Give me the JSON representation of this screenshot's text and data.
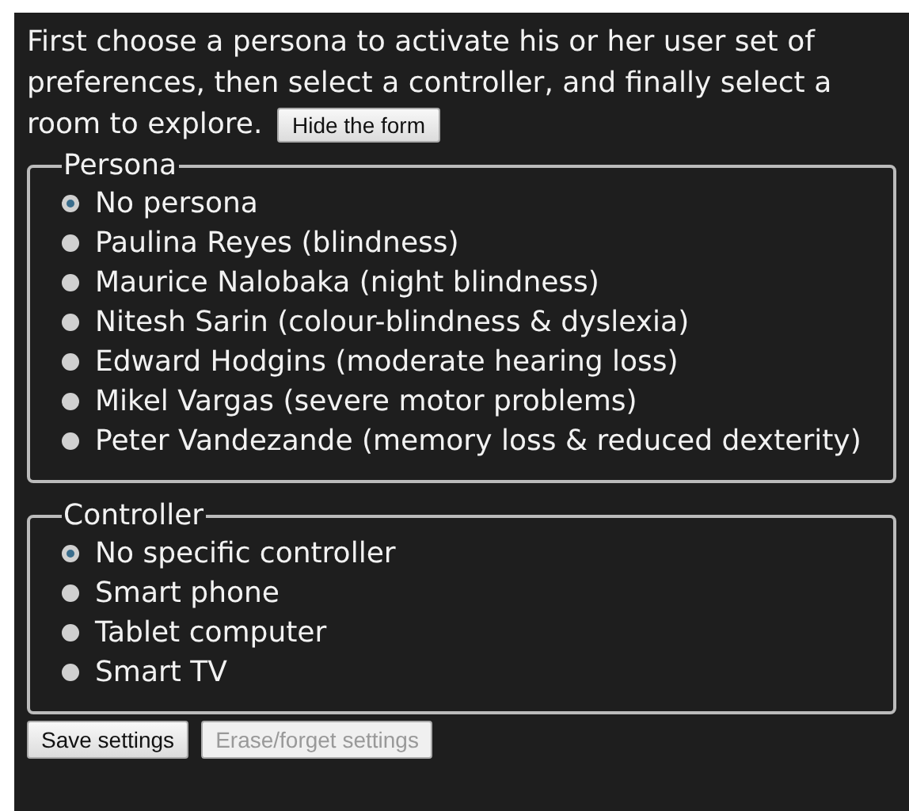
{
  "intro": {
    "text": "First choose a persona to activate his or her user set of preferences, then select a controller, and finally select a room to explore.",
    "button": "Hide the form"
  },
  "groups": [
    {
      "legend": "Persona",
      "options": [
        {
          "label": "No persona",
          "selected": true
        },
        {
          "label": "Paulina Reyes (blindness)",
          "selected": false
        },
        {
          "label": "Maurice Nalobaka (night blindness)",
          "selected": false
        },
        {
          "label": "Nitesh Sarin (colour-blindness & dyslexia)",
          "selected": false
        },
        {
          "label": "Edward Hodgins (moderate hearing loss)",
          "selected": false
        },
        {
          "label": "Mikel Vargas (severe motor problems)",
          "selected": false
        },
        {
          "label": "Peter Vandezande (memory loss & reduced dexterity)",
          "selected": false
        }
      ]
    },
    {
      "legend": "Controller",
      "options": [
        {
          "label": "No specific controller",
          "selected": true
        },
        {
          "label": "Smart phone",
          "selected": false
        },
        {
          "label": "Tablet computer",
          "selected": false
        },
        {
          "label": "Smart TV",
          "selected": false
        }
      ]
    }
  ],
  "buttons": [
    {
      "label": "Save settings",
      "disabled": false
    },
    {
      "label": "Erase/forget settings",
      "disabled": true
    }
  ]
}
